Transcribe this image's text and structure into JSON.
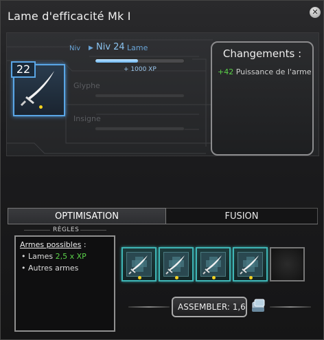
{
  "window": {
    "title": "Lame d'efficacité Mk I",
    "close_icon": "close-icon"
  },
  "item": {
    "level": "22",
    "icon": "sword-icon"
  },
  "progress": {
    "niv_label": "Niv",
    "level_text": "Niv 24",
    "name": "Lame",
    "xp_fraction": 0.48,
    "xp_gain": "+ 1000 XP",
    "glyphe_label": "Glyphe",
    "insigne_label": "Insigne"
  },
  "changes": {
    "title": "Changements :",
    "value": "+42",
    "stat": "Puissance de l'arme"
  },
  "tabs": {
    "optimisation": "OPTIMISATION",
    "fusion": "FUSION"
  },
  "rules": {
    "section_label": "RÈGLES",
    "heading": "Armes possibles",
    "heading_suffix": " :",
    "items": [
      {
        "bullet": "•",
        "name": "Lames",
        "bonus": "2,5 x XP"
      },
      {
        "bullet": "•",
        "name": "Autres armes",
        "bonus": ""
      }
    ]
  },
  "materials": {
    "slots": [
      {
        "icon": "sword-icon",
        "filled": true
      },
      {
        "icon": "sword-icon",
        "filled": true
      },
      {
        "icon": "sword-icon",
        "filled": true
      },
      {
        "icon": "sword-icon",
        "filled": true
      },
      {
        "icon": "empty-slot",
        "filled": false
      }
    ]
  },
  "assemble": {
    "label": "ASSEMBLER: 1,60",
    "icon": "money-stack-icon"
  },
  "colors": {
    "accent_blue": "#5aa6e6",
    "bonus_green": "#5bd24a",
    "slot_teal": "#3fb5b5"
  }
}
